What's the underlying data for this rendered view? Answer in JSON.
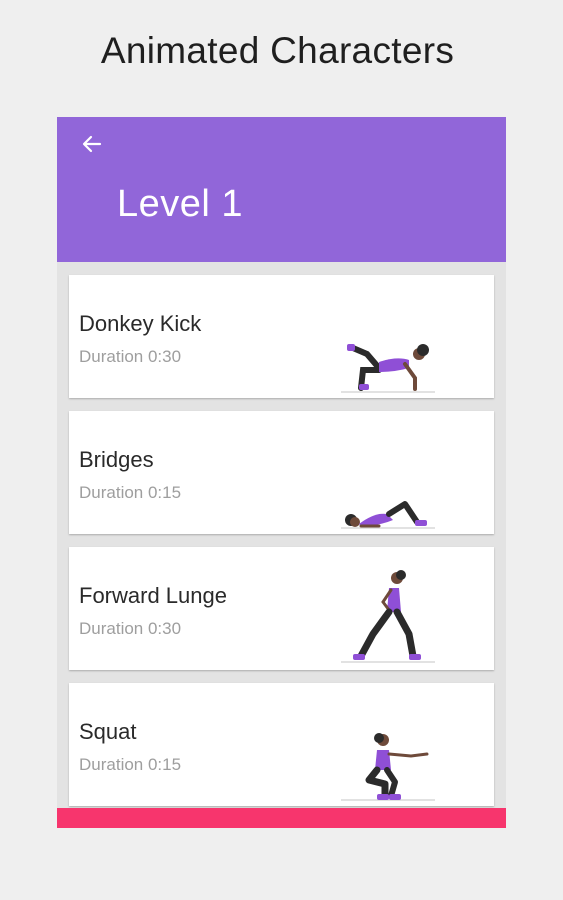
{
  "promo": {
    "title": "Animated Characters"
  },
  "appbar": {
    "title": "Level 1",
    "back_icon": "arrow-left-icon"
  },
  "colors": {
    "appbar": "#9166d9",
    "accent_bottom": "#f7356d",
    "outfit": "#8f4fd6"
  },
  "exercises": [
    {
      "name": "Donkey Kick",
      "duration": "Duration 0:30",
      "icon": "donkey-kick-figure-icon"
    },
    {
      "name": "Bridges",
      "duration": "Duration 0:15",
      "icon": "bridges-figure-icon"
    },
    {
      "name": "Forward Lunge",
      "duration": "Duration 0:30",
      "icon": "forward-lunge-figure-icon"
    },
    {
      "name": "Squat",
      "duration": "Duration 0:15",
      "icon": "squat-figure-icon"
    }
  ]
}
